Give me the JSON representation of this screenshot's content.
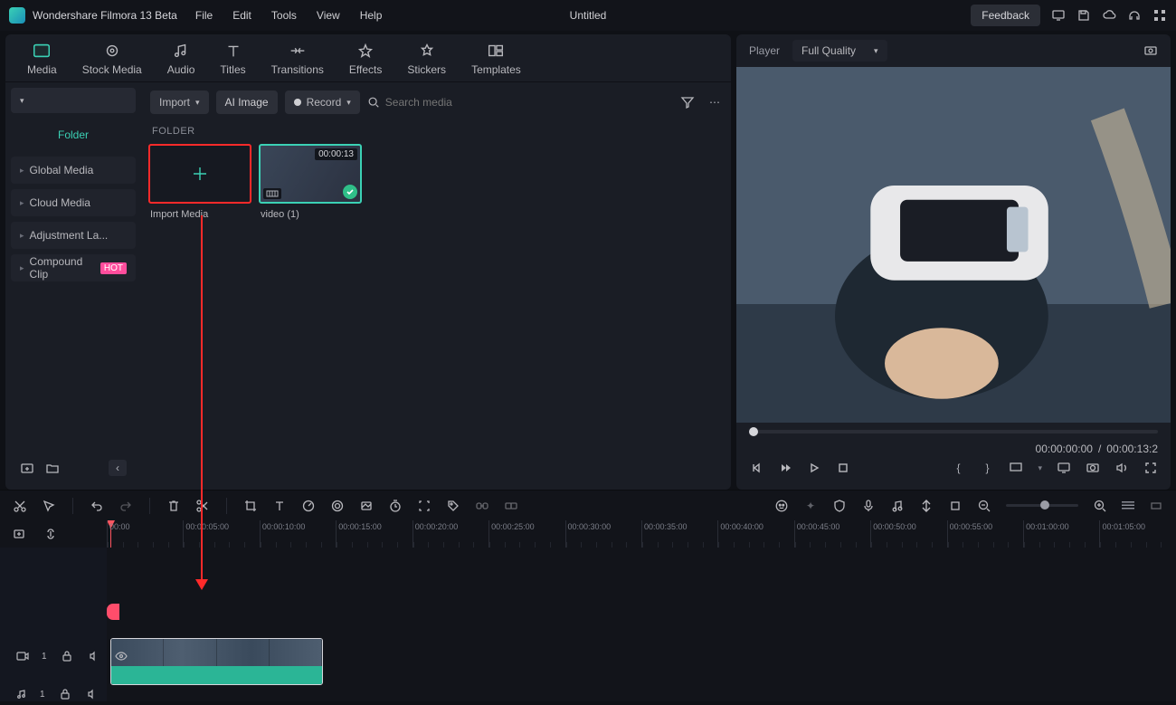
{
  "app": {
    "title": "Wondershare Filmora 13 Beta",
    "doc": "Untitled",
    "feedback": "Feedback"
  },
  "menu": [
    "File",
    "Edit",
    "Tools",
    "View",
    "Help"
  ],
  "tabs": [
    {
      "label": "Media",
      "active": true
    },
    {
      "label": "Stock Media"
    },
    {
      "label": "Audio"
    },
    {
      "label": "Titles"
    },
    {
      "label": "Transitions"
    },
    {
      "label": "Effects"
    },
    {
      "label": "Stickers"
    },
    {
      "label": "Templates"
    }
  ],
  "toolbar": {
    "import": "Import",
    "ai": "AI Image",
    "record": "Record",
    "search_ph": "Search media"
  },
  "sidebar": {
    "folder": "Folder",
    "items": [
      {
        "label": "Global Media"
      },
      {
        "label": "Cloud Media"
      },
      {
        "label": "Adjustment La..."
      },
      {
        "label": "Compound Clip",
        "tag": "HOT"
      }
    ]
  },
  "section": "FOLDER",
  "thumbs": {
    "import": "Import Media",
    "video": "video (1)",
    "duration": "00:00:13"
  },
  "preview": {
    "player": "Player",
    "quality": "Full Quality",
    "cur": "00:00:00:00",
    "sep": "/",
    "total": "00:00:13:2"
  },
  "ruler": [
    "00:00",
    "00:00:05:00",
    "00:00:10:00",
    "00:00:15:00",
    "00:00:20:00",
    "00:00:25:00",
    "00:00:30:00",
    "00:00:35:00",
    "00:00:40:00",
    "00:00:45:00",
    "00:00:50:00",
    "00:00:55:00",
    "00:01:00:00",
    "00:01:05:00"
  ],
  "tracks": {
    "video": "1",
    "audio": "1"
  }
}
